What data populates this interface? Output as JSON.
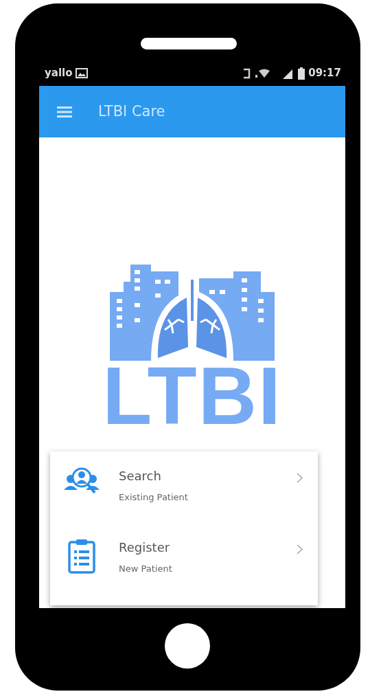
{
  "status_bar": {
    "carrier": "yallo",
    "time": "09:17"
  },
  "app_bar": {
    "title": "LTBI Care"
  },
  "logo": {
    "text": "LTBI"
  },
  "menu_items": [
    {
      "kind": "search",
      "title": "Search",
      "subtitle": "Existing Patient"
    },
    {
      "kind": "register",
      "title": "Register",
      "subtitle": "New Patient"
    }
  ]
}
